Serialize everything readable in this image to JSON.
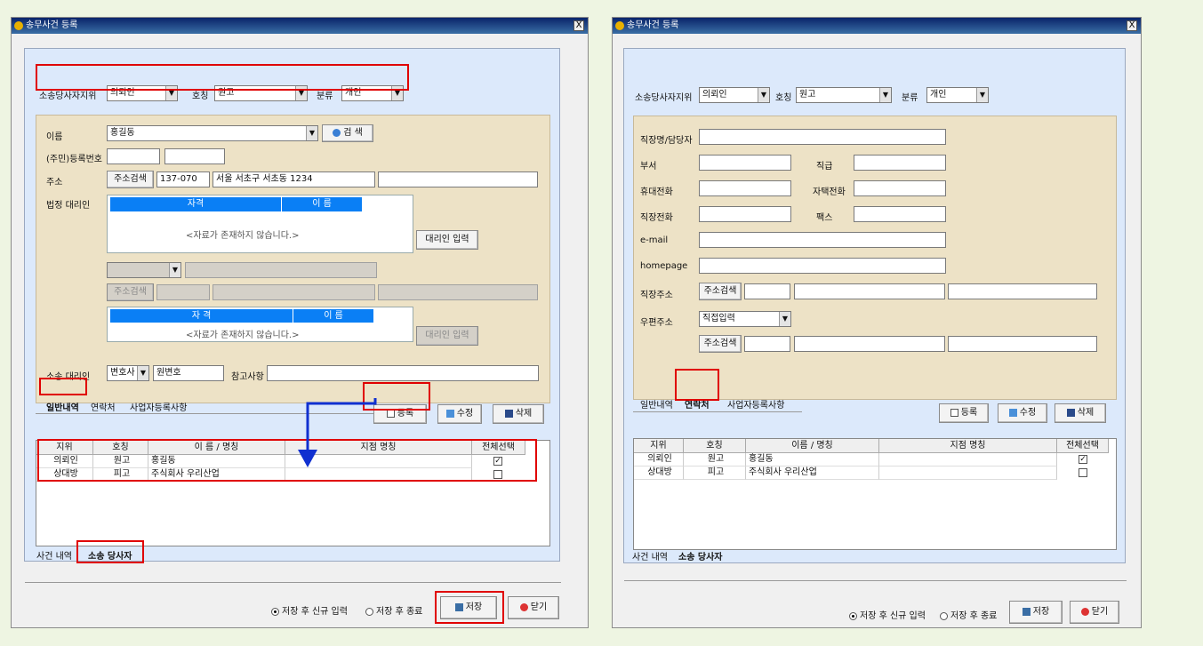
{
  "left": {
    "title": "송무사건 등록",
    "close": "X",
    "party_label": "소송당사자지위",
    "party_value": "의뢰인",
    "title_label": "호칭",
    "title_value": "원고",
    "class_label": "분류",
    "class_value": "개인",
    "name_label": "이름",
    "name_value": "홍길동",
    "search_btn": "검 색",
    "reg_label": "(주민)등록번호",
    "addr_label": "주소",
    "addr_btn": "주소검색",
    "zip": "137-070",
    "addr1": "서울 서초구 서초동 1234",
    "legal_label": "법정 대리인",
    "legal_col1": "자격",
    "legal_col2": "이 름",
    "legal_empty": "<자료가 존재하지 않습니다.>",
    "legal_btn": "대리인 입력",
    "addr_btn2": "주소검색",
    "legal2_col1": "자 격",
    "legal2_col2": "이 름",
    "legal2_empty": "<자료가 존재하지 않습니다.>",
    "legal2_btn": "대리인 입력",
    "rep_label": "소송 대리인",
    "rep_type": "변호사",
    "rep_name": "원변호",
    "note_label": "참고사항",
    "tabs": [
      "일반내역",
      "연락처",
      "사업자등록사항"
    ],
    "reg_btn": "등록",
    "edit_btn": "수정",
    "del_btn": "삭제",
    "grid_headers": [
      "지위",
      "호칭",
      "이 름 / 명칭",
      "지점 명칭",
      "전체선택"
    ],
    "rows": [
      {
        "pos": "의뢰인",
        "title": "원고",
        "name": "홍길동",
        "check": "✓"
      },
      {
        "pos": "상대방",
        "title": "피고",
        "name": "주식회사 우리산업",
        "check": ""
      }
    ],
    "bottom_tabs": [
      "사건 내역",
      "소송 당사자"
    ],
    "radio1": "저장 후 신규 입력",
    "radio2": "저장 후 종료",
    "save_btn": "저장",
    "close_btn": "닫기"
  },
  "right": {
    "title": "송무사건 등록",
    "close": "X",
    "party_label": "소송당사자지위",
    "party_value": "의뢰인",
    "title_label": "호칭",
    "title_value": "원고",
    "class_label": "분류",
    "class_value": "개인",
    "f_company": "직장명/담당자",
    "f_dept": "부서",
    "f_rank": "직급",
    "f_mobile": "휴대전화",
    "f_home": "자택전화",
    "f_work": "직장전화",
    "f_fax": "팩스",
    "f_email": "e-mail",
    "f_homepage": "homepage",
    "f_workaddr": "직장주소",
    "addr_btn": "주소검색",
    "f_mailaddr": "우편주소",
    "mail_value": "직접입력",
    "addr_btn2": "주소검색",
    "tabs": [
      "일반내역",
      "연락처",
      "사업자등록사항"
    ],
    "reg_btn": "등록",
    "edit_btn": "수정",
    "del_btn": "삭제",
    "grid_headers": [
      "지위",
      "호칭",
      "이름 / 명칭",
      "지점 명칭",
      "전체선택"
    ],
    "rows": [
      {
        "pos": "의뢰인",
        "title": "원고",
        "name": "홍길동",
        "check": "✓"
      },
      {
        "pos": "상대방",
        "title": "피고",
        "name": "주식회사 우리산업",
        "check": ""
      }
    ],
    "bottom_tabs": [
      "사건 내역",
      "소송 당사자"
    ],
    "radio1": "저장 후 신규 입력",
    "radio2": "저장 후 종료",
    "save_btn": "저장",
    "close_btn": "닫기"
  }
}
